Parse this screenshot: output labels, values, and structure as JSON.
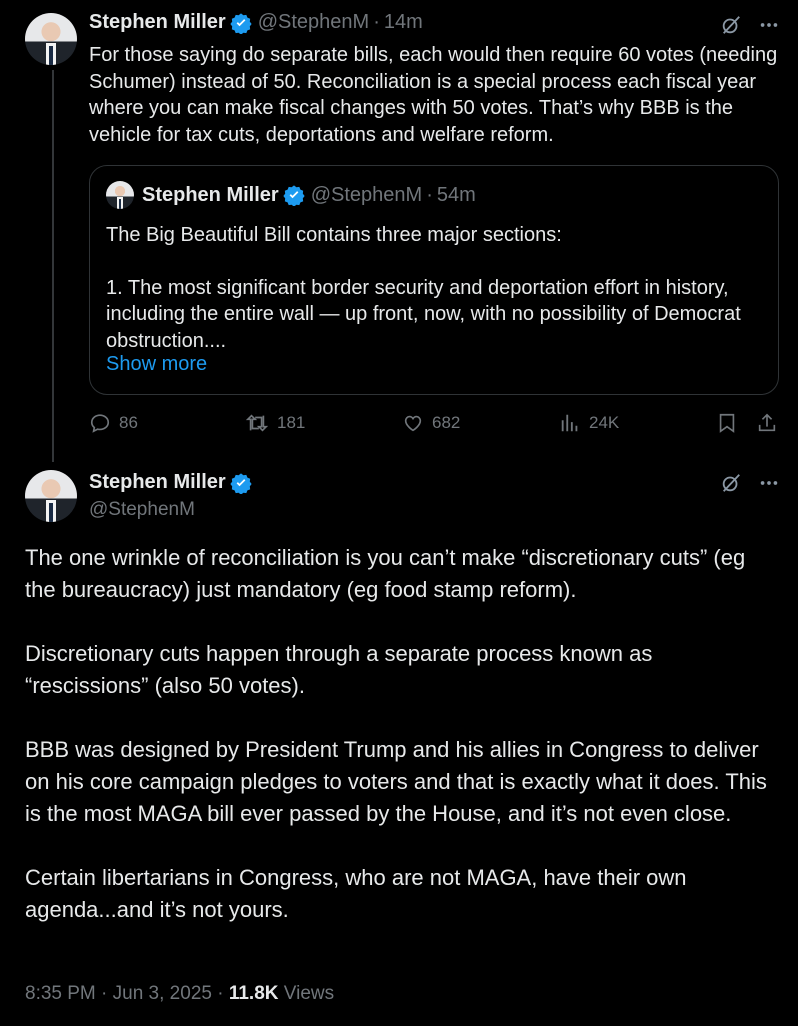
{
  "tweet1": {
    "author_name": "Stephen Miller",
    "handle": "@StephenM",
    "time": "14m",
    "separator": "·",
    "text": "For those saying do separate bills, each would then require 60 votes (needing Schumer) instead of 50. Reconciliation is a special process each fiscal year where you can make fiscal changes with 50 votes. That’s why BBB is the vehicle for tax cuts, deportations and welfare reform.",
    "quote": {
      "author_name": "Stephen Miller",
      "handle": "@StephenM",
      "time": "54m",
      "line1": "The Big Beautiful Bill contains three major sections:",
      "line2": "1. The most significant border security and deportation effort in history, including the entire wall — up front, now, with no possibility of Democrat obstruction....",
      "show_more": "Show more"
    },
    "actions": {
      "replies": "86",
      "reposts": "181",
      "likes": "682",
      "views": "24K"
    }
  },
  "tweet2": {
    "author_name": "Stephen Miller",
    "handle": "@StephenM",
    "paragraphs": [
      "The one wrinkle of reconciliation is you can’t make “discretionary cuts” (eg the bureaucracy) just mandatory (eg food stamp reform).",
      "Discretionary cuts happen through a separate process known as “rescissions” (also 50 votes).",
      "BBB was designed by President Trump and his allies in Congress to deliver on his core campaign pledges to voters and that is exactly what it does. This is the most MAGA bill ever passed by the House, and it’s not even close.",
      "Certain libertarians in Congress, who are not MAGA, have their own agenda...and it’s not yours."
    ],
    "timestamp": "8:35 PM · Jun 3, 2025",
    "dot": " · ",
    "views_count": "11.8K",
    "views_label": " Views"
  },
  "colors": {
    "background": "#000000",
    "text": "#e7e9ea",
    "muted": "#71767b",
    "accent": "#1d9bf0",
    "border": "#2f3336"
  },
  "icons": [
    "verified-badge-icon",
    "grok-icon",
    "more-icon",
    "reply-icon",
    "repost-icon",
    "like-icon",
    "views-icon",
    "bookmark-icon",
    "share-icon"
  ]
}
